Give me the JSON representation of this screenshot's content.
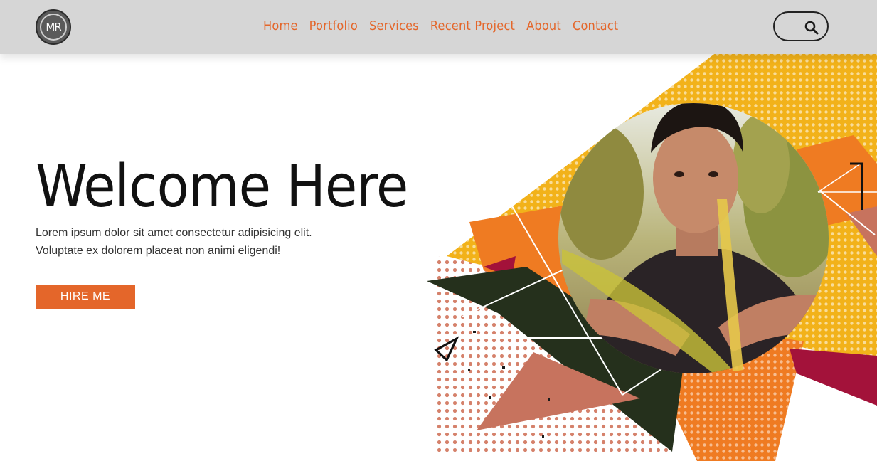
{
  "brand": {
    "logo_text": "MR"
  },
  "nav": {
    "items": [
      {
        "label": "Home"
      },
      {
        "label": "Portfolio"
      },
      {
        "label": "Services"
      },
      {
        "label": "Recent Project"
      },
      {
        "label": "About"
      },
      {
        "label": "Contact"
      }
    ]
  },
  "search": {
    "icon": "search-icon"
  },
  "hero": {
    "title": "Welcome Here",
    "line1": "Lorem ipsum dolor sit amet consectetur adipisicing elit.",
    "line2": "Voluptate ex dolorem placeat non animi eligendi!",
    "cta_label": "HIRE ME"
  },
  "colors": {
    "accent": "#e4662a",
    "nav_bg": "#d6d6d6",
    "yellow": "#f2b21a",
    "orange": "#ef7b22",
    "dark_green": "#25301c",
    "salmon": "#c7735e",
    "crimson": "#a3123a"
  }
}
